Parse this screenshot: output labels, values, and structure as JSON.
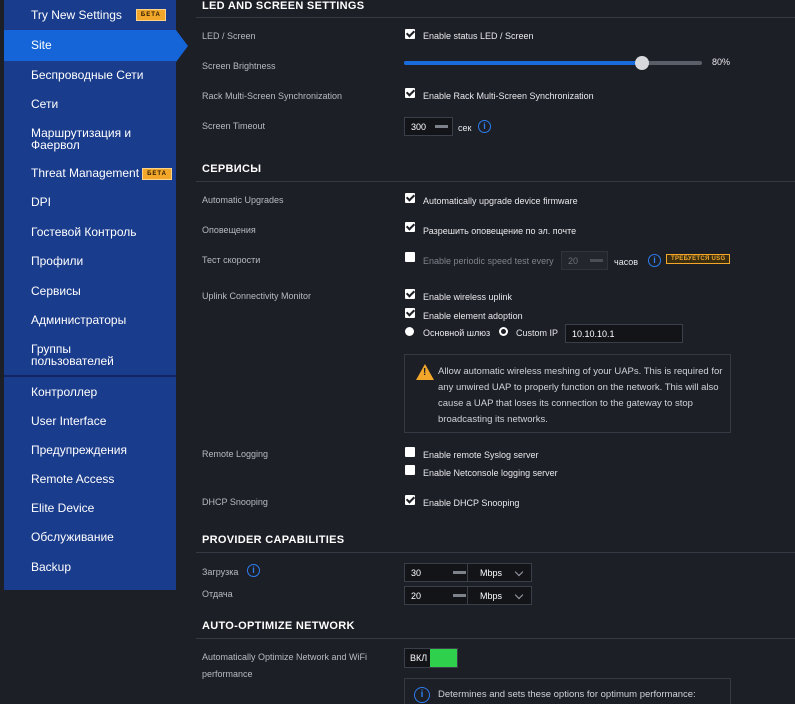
{
  "sidebar": {
    "items": [
      {
        "label": "Try New Settings",
        "beta": "БЕТА"
      },
      {
        "label": "Site"
      },
      {
        "label": "Беспроводные Сети"
      },
      {
        "label": "Сети"
      },
      {
        "label": "Маршрутизация и Фаервол"
      },
      {
        "label": "Threat Management",
        "beta": "БЕТА"
      },
      {
        "label": "DPI"
      },
      {
        "label": "Гостевой Контроль"
      },
      {
        "label": "Профили"
      },
      {
        "label": "Сервисы"
      },
      {
        "label": "Администраторы"
      },
      {
        "label": "Группы пользователей"
      },
      {
        "label": "Контроллер"
      },
      {
        "label": "User Interface"
      },
      {
        "label": "Предупреждения"
      },
      {
        "label": "Remote Access"
      },
      {
        "label": "Elite Device"
      },
      {
        "label": "Обслуживание"
      },
      {
        "label": "Backup"
      }
    ],
    "active_index": 1,
    "colors": {
      "bg": "#1a3c8c",
      "active": "#1565d8"
    }
  },
  "led": {
    "title": "LED AND SCREEN SETTINGS",
    "led_label": "LED / Screen",
    "led_cb_label": "Enable status LED / Screen",
    "led_checked": true,
    "brightness_label": "Screen Brightness",
    "brightness_value": "80%",
    "brightness_fraction": 0.8,
    "rack_label": "Rack Multi-Screen Synchronization",
    "rack_cb_label": "Enable Rack Multi-Screen Synchronization",
    "rack_checked": true,
    "timeout_label": "Screen Timeout",
    "timeout_value": "300",
    "timeout_unit": "сек"
  },
  "services": {
    "title": "СЕРВИСЫ",
    "upgrades_label": "Automatic Upgrades",
    "upgrades_cb": "Automatically upgrade device firmware",
    "notify_label": "Оповещения",
    "notify_cb": "Разрешить оповещение по эл. почте",
    "speed_label": "Тест скорости",
    "speed_cb": "Enable periodic speed test every",
    "speed_value": "20",
    "speed_unit": "часов",
    "speed_badge": "ТРЕБУЕТСЯ USG",
    "uplink_label": "Uplink Connectivity Monitor",
    "uplink_cb1": "Enable wireless uplink",
    "uplink_cb2": "Enable element adoption",
    "radio_gateway": "Основной шлюз",
    "radio_custom": "Custom IP",
    "custom_ip": "10.10.10.1",
    "warning": "Allow automatic wireless meshing of your UAPs. This is required for any unwired UAP to properly function on the network. This will also cause a UAP that loses its connection to the gateway to stop broadcasting its networks.",
    "remote_label": "Remote Logging",
    "remote_cb1": "Enable remote Syslog server",
    "remote_cb2": "Enable Netconsole logging server",
    "dhcp_label": "DHCP Snooping",
    "dhcp_cb": "Enable DHCP Snooping"
  },
  "provider": {
    "title": "PROVIDER CAPABILITIES",
    "download_label": "Загрузка",
    "download_value": "30",
    "download_unit": "Mbps",
    "upload_label": "Отдача",
    "upload_value": "20",
    "upload_unit": "Mbps"
  },
  "auto": {
    "title": "AUTO-OPTIMIZE NETWORK",
    "label": "Automatically Optimize Network and WiFi performance",
    "toggle_label": "ВКЛ",
    "toggle_on": true,
    "info": "Determines and sets these options for optimum performance:"
  }
}
